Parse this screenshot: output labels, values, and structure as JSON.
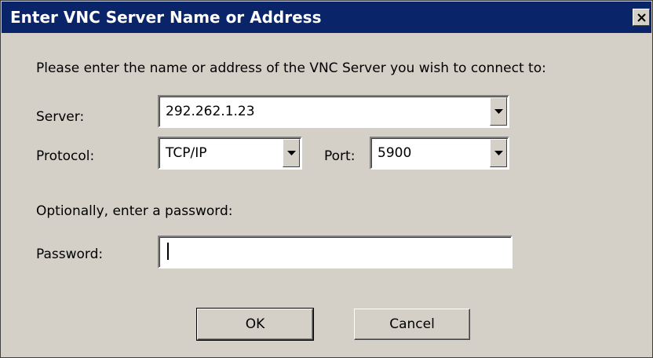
{
  "window": {
    "title": "Enter VNC Server Name or Address"
  },
  "dialog": {
    "instruction": "Please enter the name or address of the VNC Server you wish to connect to:",
    "server": {
      "label": "Server:",
      "value": "292.262.1.23"
    },
    "protocol": {
      "label": "Protocol:",
      "value": "TCP/IP"
    },
    "port": {
      "label": "Port:",
      "value": "5900"
    },
    "password_hint": "Optionally, enter a password:",
    "password": {
      "label": "Password:",
      "value": ""
    },
    "ok_label": "OK",
    "cancel_label": "Cancel"
  },
  "icons": {
    "close": "close-icon",
    "dropdown": "chevron-down-icon"
  }
}
